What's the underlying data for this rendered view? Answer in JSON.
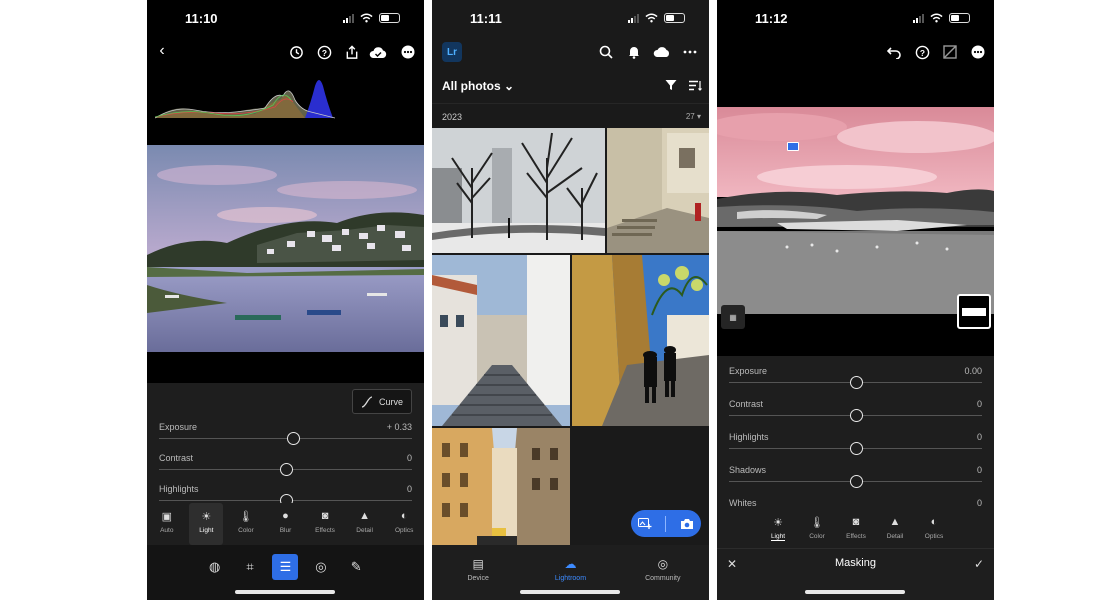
{
  "panel_light": {
    "time": "11:10",
    "curve_label": "Curve",
    "sliders": [
      {
        "label": "Exposure",
        "value": "+ 0.33",
        "level": 0.5
      },
      {
        "label": "Contrast",
        "value": "0",
        "level": 0.5
      },
      {
        "label": "Highlights",
        "value": "0",
        "level": 0.5
      }
    ],
    "tabs": [
      {
        "label": "Auto",
        "icon": "auto-icon"
      },
      {
        "label": "Light",
        "icon": "sun-icon"
      },
      {
        "label": "Color",
        "icon": "thermometer-icon"
      },
      {
        "label": "Blur",
        "icon": "drop-icon"
      },
      {
        "label": "Effects",
        "icon": "vignette-icon"
      },
      {
        "label": "Detail",
        "icon": "triangle-icon"
      },
      {
        "label": "Optics",
        "icon": "lens-icon"
      }
    ]
  },
  "panel_library": {
    "time": "11:11",
    "app_badge": "Lr",
    "album": "All photos",
    "year": "2023",
    "count": "27",
    "nav": [
      {
        "label": "Device",
        "icon": "device-icon"
      },
      {
        "label": "Lightroom",
        "icon": "lightroom-cloud-icon"
      },
      {
        "label": "Community",
        "icon": "globe-icon"
      }
    ]
  },
  "panel_masking": {
    "time": "11:12",
    "sliders": [
      {
        "label": "Exposure",
        "value": "0.00",
        "level": 0.5
      },
      {
        "label": "Contrast",
        "value": "0",
        "level": 0.5
      },
      {
        "label": "Highlights",
        "value": "0",
        "level": 0.5
      },
      {
        "label": "Shadows",
        "value": "0",
        "level": 0.5
      },
      {
        "label": "Whites",
        "value": "0",
        "level": 0.5
      }
    ],
    "tabs": [
      {
        "label": "Light",
        "icon": "sun-icon"
      },
      {
        "label": "Color",
        "icon": "thermometer-icon"
      },
      {
        "label": "Effects",
        "icon": "vignette-icon"
      },
      {
        "label": "Detail",
        "icon": "triangle-icon"
      },
      {
        "label": "Optics",
        "icon": "lens-icon"
      }
    ],
    "title": "Masking"
  },
  "colors": {
    "accent": "#2e6ee6",
    "panel": "#1e1e1e",
    "mask_overlay": "#e9a3ad"
  }
}
